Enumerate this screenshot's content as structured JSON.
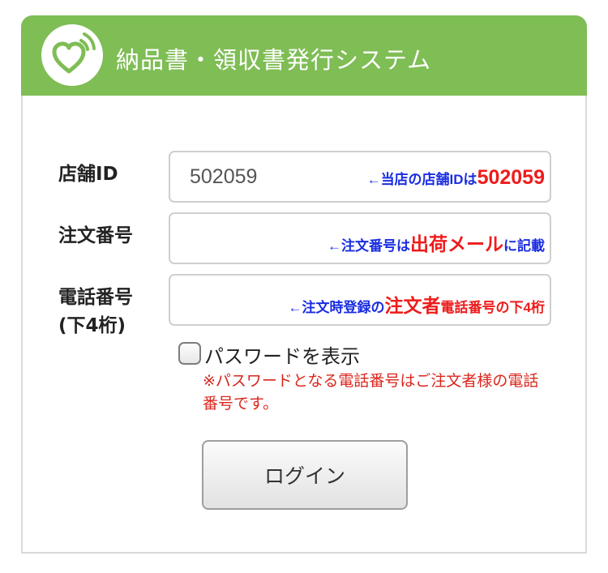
{
  "header": {
    "title": "納品書・領収書発行システム",
    "logo_icon": "heart-signal-icon",
    "color": "#7fbd55"
  },
  "form": {
    "store_id": {
      "label": "店舗ID",
      "value": "502059",
      "hint_prefix": "←当店の店舗IDは",
      "hint_emphasis": "502059"
    },
    "order_number": {
      "label": "注文番号",
      "value": "",
      "hint_prefix": "←注文番号は",
      "hint_emphasis": "出荷メール",
      "hint_suffix": "に記載"
    },
    "phone": {
      "label_line1": "電話番号",
      "label_line2": "(下4桁)",
      "value": "",
      "hint_prefix": "←注文時登録の",
      "hint_emphasis": "注文者",
      "hint_suffix": "電話番号の下4桁"
    },
    "show_password_label": "パスワードを表示",
    "show_password_checked": false,
    "note": "※パスワードとなる電話番号はご注文者様の電話番号です。",
    "login_button": "ログイン"
  },
  "colors": {
    "hint_blue": "#1a2de0",
    "hint_red": "#ee1c1c",
    "note_red": "#d9261c"
  }
}
